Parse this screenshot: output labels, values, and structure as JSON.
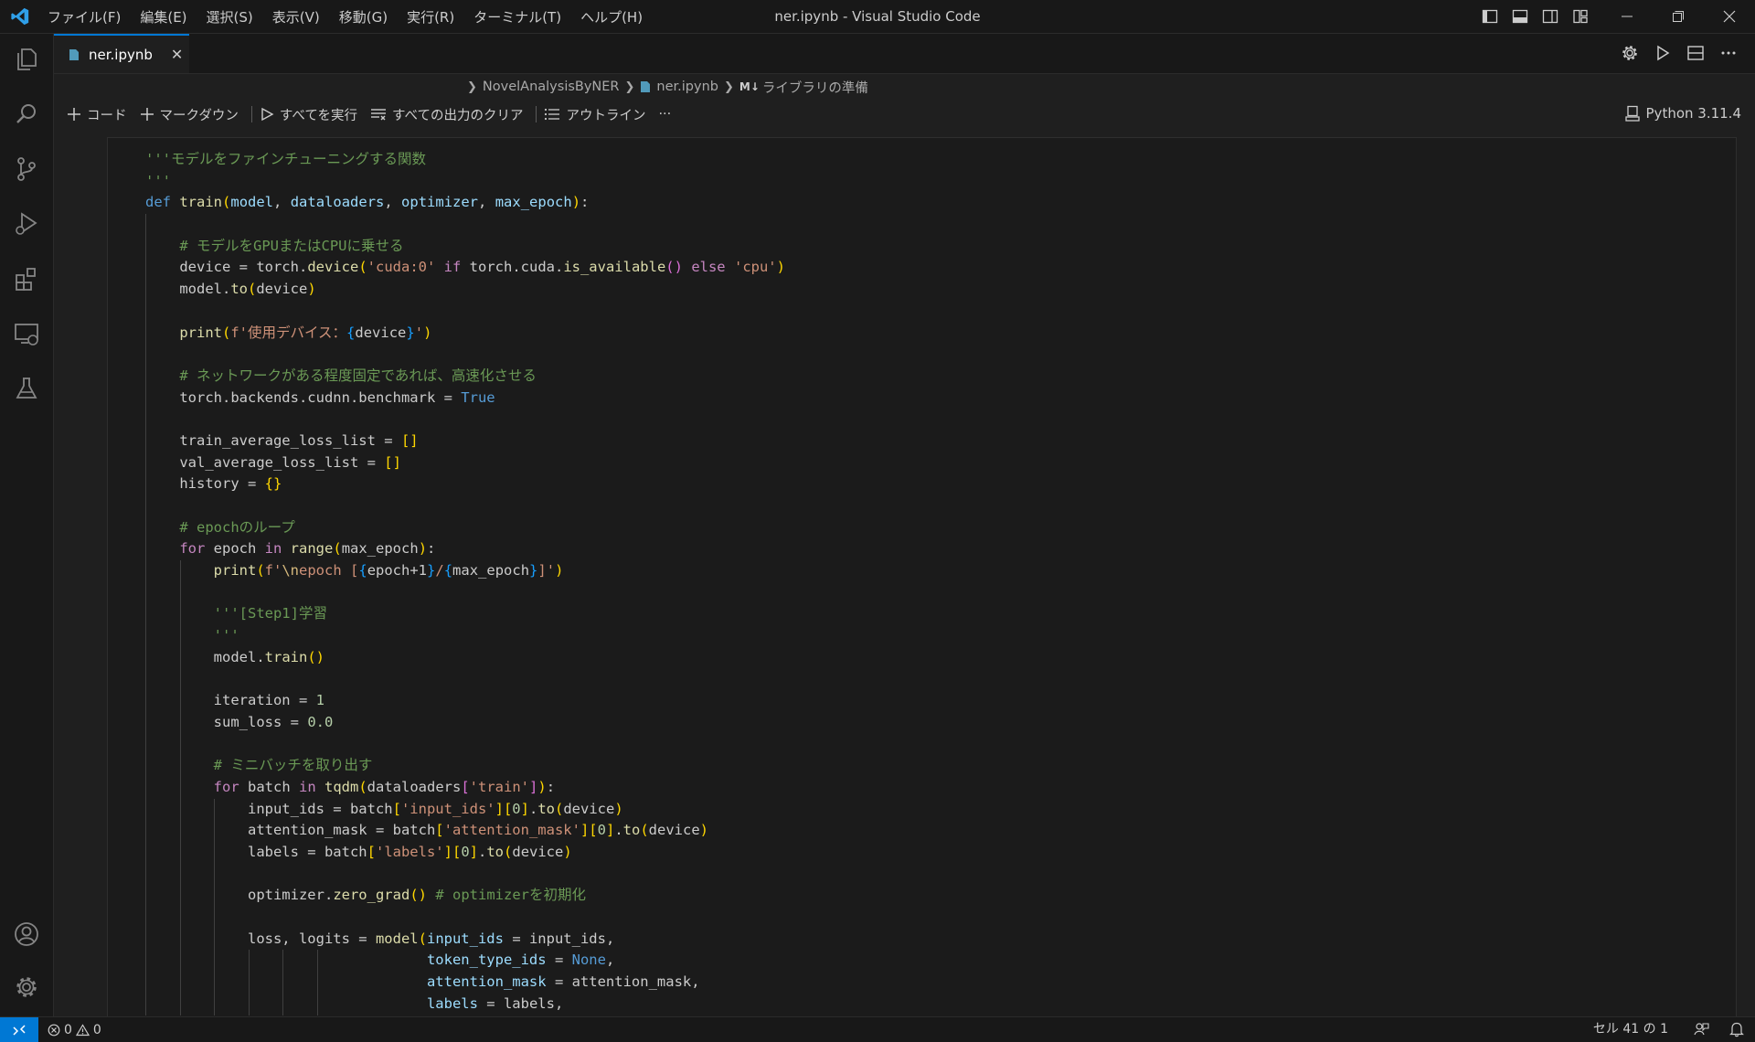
{
  "window": {
    "title": "ner.ipynb - Visual Studio Code",
    "menus": [
      "ファイル(F)",
      "編集(E)",
      "選択(S)",
      "表示(V)",
      "移動(G)",
      "実行(R)",
      "ターミナル(T)",
      "ヘルプ(H)"
    ]
  },
  "tab": {
    "label": "ner.ipynb",
    "close": "✕"
  },
  "breadcrumb": {
    "folder": "NovelAnalysisByNER",
    "file": "ner.ipynb",
    "md_badge": "M↓",
    "section": "ライブラリの準備"
  },
  "toolbar": {
    "code": "コード",
    "markdown": "マークダウン",
    "run_all": "すべてを実行",
    "clear_outputs": "すべての出力のクリア",
    "outline": "アウトライン",
    "more": "···"
  },
  "kernel": {
    "label": "Python 3.11.4"
  },
  "code": {
    "l01": "'''モデルをファインチューニングする関数",
    "l02": "'''",
    "l03": {
      "kw": "def",
      "name": "train",
      "p1": "model",
      "p2": "dataloaders",
      "p3": "optimizer",
      "p4": "max_epoch"
    },
    "l04": "# モデルをGPUまたはCPUに乗せる",
    "l05": {
      "a": "device = torch.",
      "b": "device",
      "c": "'cuda:0'",
      "d": "if",
      "e": " torch.cuda.",
      "f": "is_available",
      "g": "else",
      "h": "'cpu'"
    },
    "l06": {
      "a": "model.",
      "b": "to",
      "c": "device"
    },
    "l07": {
      "a": "print",
      "b": "f'使用デバイス：",
      "c": "device",
      "d": "'"
    },
    "l08": "# ネットワークがある程度固定であれば、高速化させる",
    "l09": {
      "a": "torch.backends.cudnn.benchmark = ",
      "b": "True"
    },
    "l10": "train_average_loss_list = ",
    "l11": "val_average_loss_list = ",
    "l12": "history = ",
    "l13": "# epochのループ",
    "l14": {
      "a": "for",
      "b": " epoch ",
      "c": "in",
      "d": "range",
      "e": "max_epoch"
    },
    "l15": {
      "a": "print",
      "b": "f'",
      "c": "\\n",
      "d": "epoch [",
      "e": "epoch+1",
      "f": "/",
      "g": "max_epoch",
      "h": "]'"
    },
    "l16": "'''[Step1]学習",
    "l17": "'''",
    "l18": {
      "a": "model.",
      "b": "train"
    },
    "l19": {
      "a": "iteration = ",
      "b": "1"
    },
    "l20": {
      "a": "sum_loss = ",
      "b": "0.0"
    },
    "l21": "# ミニバッチを取り出す",
    "l22": {
      "a": "for",
      "b": " batch ",
      "c": "in",
      "d": "tqdm",
      "e": "dataloaders",
      "f": "'train'"
    },
    "l23": {
      "a": "input_ids = batch",
      "b": "'input_ids'",
      "c": "0",
      "d": "to",
      "e": "device"
    },
    "l24": {
      "a": "attention_mask = batch",
      "b": "'attention_mask'",
      "c": "0",
      "d": "to",
      "e": "device"
    },
    "l25": {
      "a": "labels = batch",
      "b": "'labels'",
      "c": "0",
      "d": "to",
      "e": "device"
    },
    "l26": {
      "a": "optimizer.",
      "b": "zero_grad",
      "c": "# optimizerを初期化"
    },
    "l27": {
      "a": "loss, logits = ",
      "b": "model",
      "c": "input_ids",
      "d": " = input_ids,"
    },
    "l28": {
      "a": "token_type_ids",
      "b": " = ",
      "c": "None",
      "d": ","
    },
    "l29": {
      "a": "attention_mask",
      "b": " = attention_mask,"
    },
    "l30": {
      "a": "labels",
      "b": " = labels,"
    }
  },
  "statusbar": {
    "errors": "0",
    "warnings": "0",
    "cell_position": "セル 41 の 1"
  }
}
